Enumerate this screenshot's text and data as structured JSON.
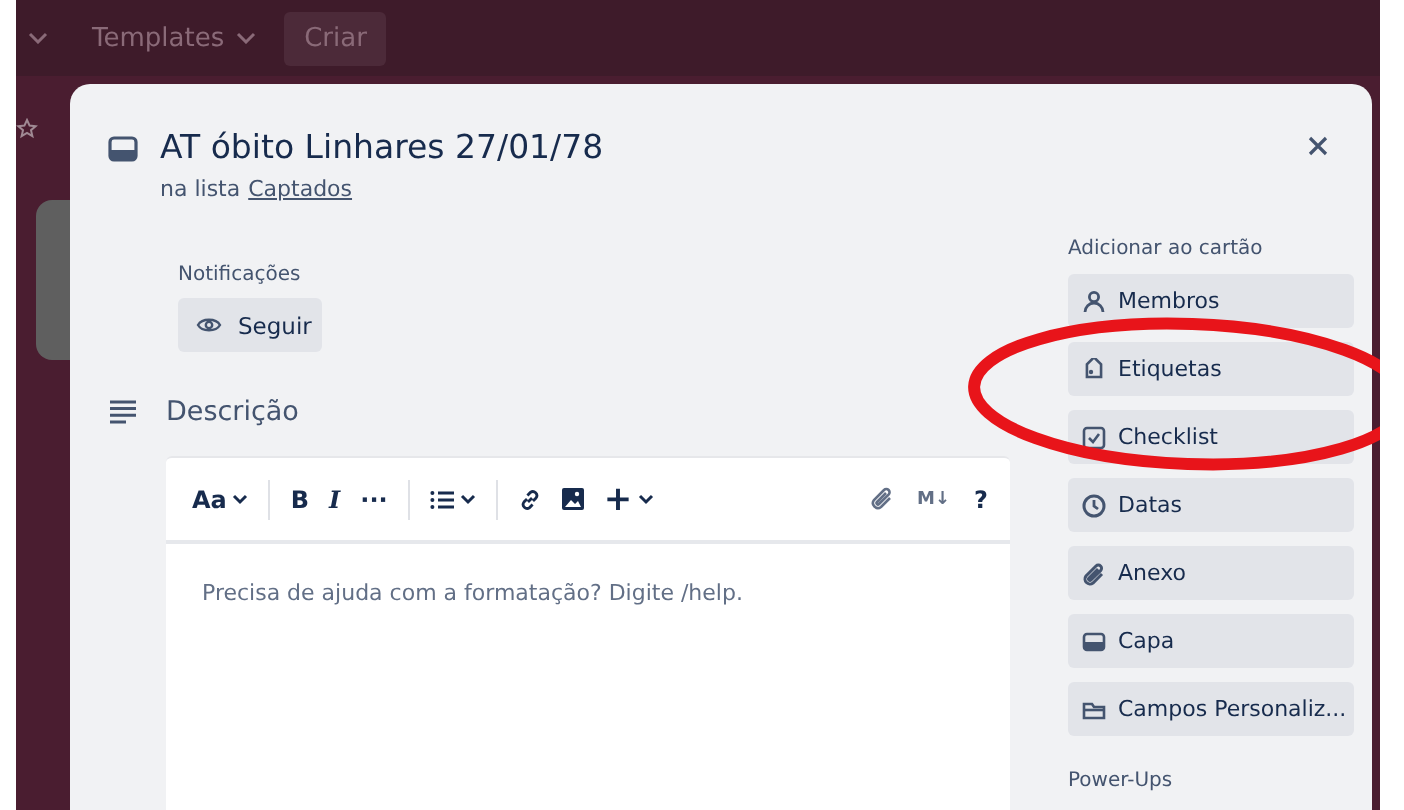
{
  "top_bar": {
    "menus": [
      {
        "label": "Templates"
      }
    ],
    "create_button": "Criar"
  },
  "card": {
    "title": "AT óbito Linhares 27/01/78",
    "list_prefix": "na lista",
    "list_name": "Captados",
    "notifications": {
      "label": "Notificações",
      "button": "Seguir"
    },
    "description": {
      "heading": "Descrição",
      "toolbar": [
        {
          "kind": "text-style",
          "label": "Aa"
        },
        {
          "kind": "bold",
          "label": "B"
        },
        {
          "kind": "italic",
          "label": "I"
        },
        {
          "kind": "more",
          "label": "···"
        },
        {
          "kind": "list"
        },
        {
          "kind": "link"
        },
        {
          "kind": "image"
        },
        {
          "kind": "insert",
          "label": "+"
        },
        {
          "kind": "attach"
        },
        {
          "kind": "markdown",
          "label": "M↓"
        },
        {
          "kind": "help",
          "label": "?"
        }
      ],
      "placeholder": "Precisa de ajuda com a formatação? Digite /help."
    },
    "sidebar": {
      "heading": "Adicionar ao cartão",
      "buttons": [
        {
          "kind": "members",
          "label": "Membros"
        },
        {
          "kind": "labels",
          "label": "Etiquetas"
        },
        {
          "kind": "checklist",
          "label": "Checklist"
        },
        {
          "kind": "dates",
          "label": "Datas"
        },
        {
          "kind": "attachment",
          "label": "Anexo"
        },
        {
          "kind": "cover",
          "label": "Capa"
        },
        {
          "kind": "fields",
          "label": "Campos Personaliz..."
        }
      ],
      "powerups_heading": "Power-Ups"
    }
  },
  "annotation": {
    "kind": "ellipse",
    "color": "#e8141a"
  }
}
